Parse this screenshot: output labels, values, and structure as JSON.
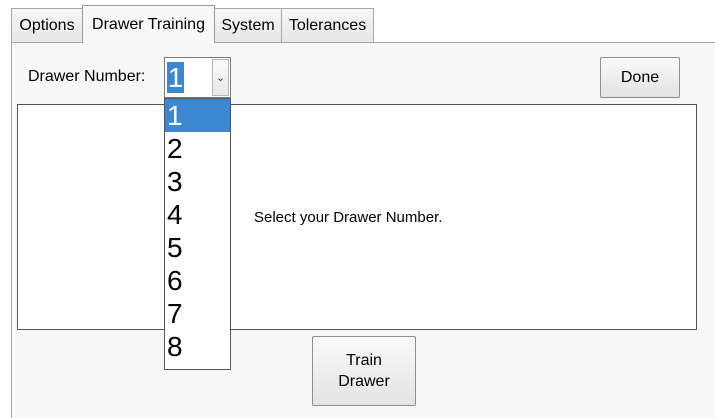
{
  "tabs": [
    {
      "label": "Options",
      "active": false
    },
    {
      "label": "Drawer Training",
      "active": true
    },
    {
      "label": "System",
      "active": false
    },
    {
      "label": "Tolerances",
      "active": false
    }
  ],
  "drawer_select": {
    "label": "Drawer Number:",
    "value": "1",
    "options": [
      "1",
      "2",
      "3",
      "4",
      "5",
      "6",
      "7",
      "8"
    ],
    "arrow_icon": "chevron-down-icon"
  },
  "done_button": {
    "label": "Done"
  },
  "message": "Select your Drawer Number.",
  "train_button": {
    "line1": "Train",
    "line2": "Drawer"
  },
  "colors": {
    "selection": "#3b87d0",
    "panel": "#f8f8f8"
  }
}
